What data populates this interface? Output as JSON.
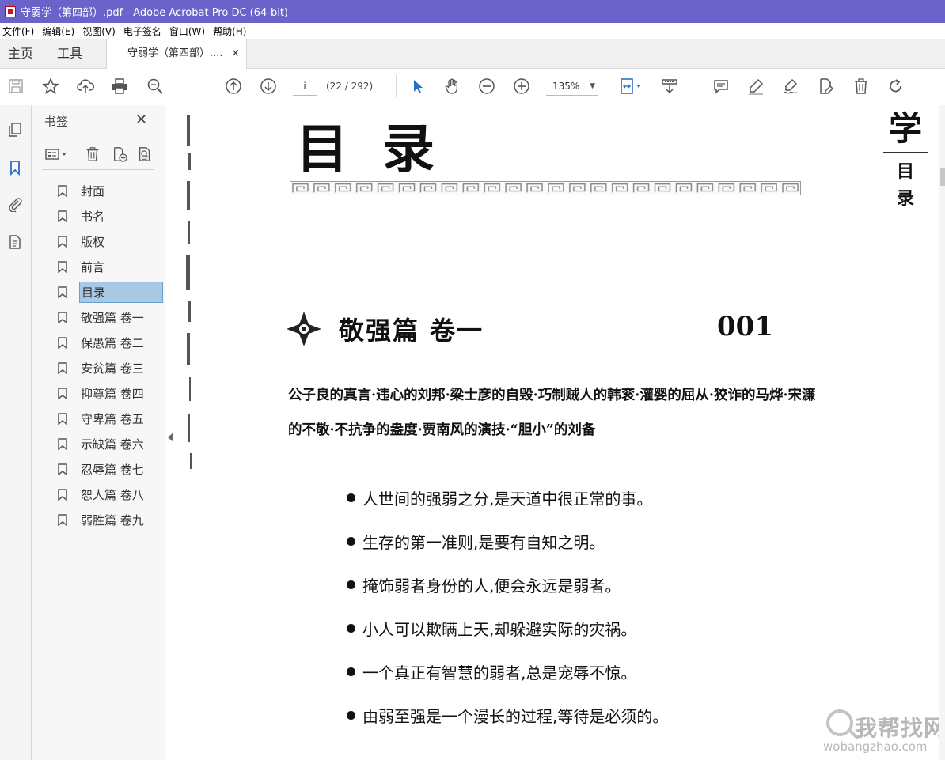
{
  "window": {
    "title": "守弱学（第四部）.pdf - Adobe Acrobat Pro DC (64-bit)"
  },
  "menu": [
    "文件(F)",
    "编辑(E)",
    "视图(V)",
    "电子签名",
    "窗口(W)",
    "帮助(H)"
  ],
  "tabs": {
    "home": "主页",
    "tools": "工具",
    "document": "守弱学（第四部）....",
    "close": "×"
  },
  "toolbar": {
    "page_input": "i",
    "page_count": "(22 / 292)",
    "zoom": "135%"
  },
  "bookmarks": {
    "title": "书签",
    "close": "✕",
    "items": [
      {
        "label": "封面",
        "selected": false
      },
      {
        "label": "书名",
        "selected": false
      },
      {
        "label": "版权",
        "selected": false
      },
      {
        "label": "前言",
        "selected": false
      },
      {
        "label": "目录",
        "selected": true
      },
      {
        "label": "敬强篇  卷一",
        "selected": false
      },
      {
        "label": "保愚篇  卷二",
        "selected": false
      },
      {
        "label": "安贫篇  卷三",
        "selected": false
      },
      {
        "label": "抑尊篇  卷四",
        "selected": false
      },
      {
        "label": "守卑篇  卷五",
        "selected": false
      },
      {
        "label": "示缺篇  卷六",
        "selected": false
      },
      {
        "label": "忍辱篇  卷七",
        "selected": false
      },
      {
        "label": "恕人篇  卷八",
        "selected": false
      },
      {
        "label": "弱胜篇  卷九",
        "selected": false
      }
    ]
  },
  "document": {
    "heading": "目 录",
    "side_tag_big": "学",
    "side_tag_small_1": "目",
    "side_tag_small_2": "录",
    "chapter_title": "敬强篇 卷一",
    "chapter_page": "001",
    "chapter_summary": "公子良的真言·违心的刘邦·梁士彦的自毁·巧制贼人的韩衮·灌婴的屈从·狡诈的马烨·宋濂的不敬·不抗争的盎度·贾南风的演技·“胆小”的刘备",
    "bullets": [
      "人世间的强弱之分,是天道中很正常的事。",
      "生存的第一准则,是要有自知之明。",
      "掩饰弱者身份的人,便会永远是弱者。",
      "小人可以欺瞒上天,却躲避实际的灾祸。",
      "一个真正有智慧的弱者,总是宠辱不惊。",
      "由弱至强是一个漫长的过程,等待是必须的。"
    ]
  },
  "watermark": {
    "cn": "我帮找网",
    "en": "wobangzhao.com"
  },
  "colors": {
    "titlebar": "#6b63c9",
    "selection": "#a8c8e4",
    "accent_blue": "#2d6fc4"
  }
}
